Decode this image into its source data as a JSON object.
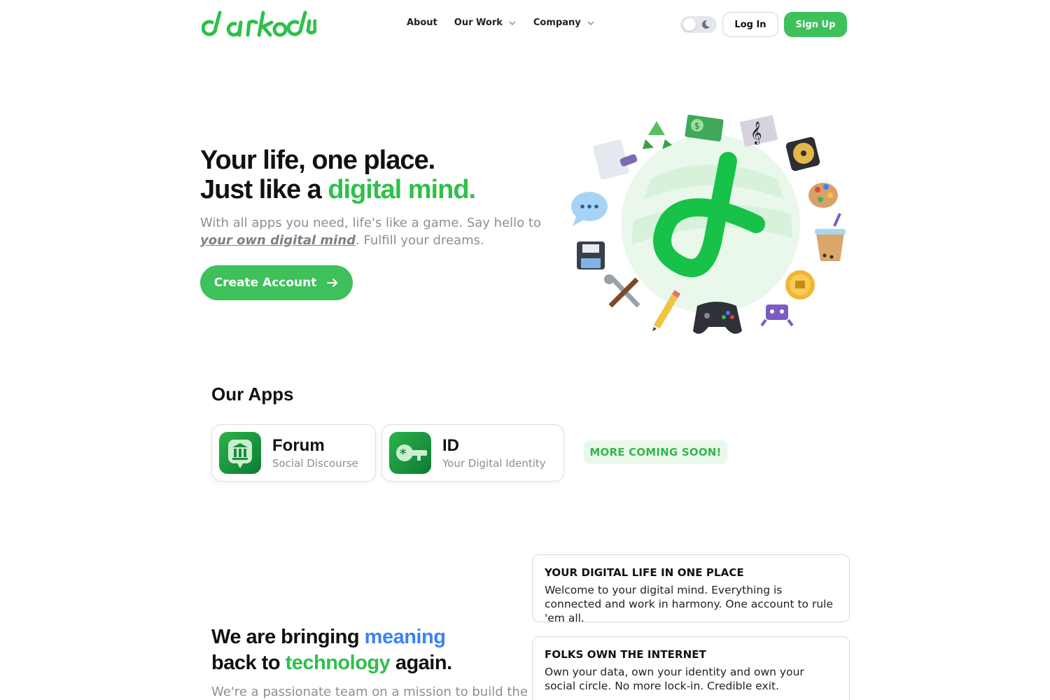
{
  "header": {
    "brand": "darkodu",
    "nav": [
      {
        "label": "About",
        "has_dropdown": false
      },
      {
        "label": "Our Work",
        "has_dropdown": true
      },
      {
        "label": "Company",
        "has_dropdown": true
      }
    ],
    "theme_toggle": {
      "mode": "light",
      "icon": "moon-icon"
    },
    "login_label": "Log In",
    "signup_label": "Sign Up"
  },
  "hero": {
    "title_line1": "Your life, one place.",
    "title_line2_prefix": "Just like a ",
    "title_line2_highlight": "digital mind.",
    "subtitle_part1": "With all apps you need, life's like a game. Say hello to ",
    "subtitle_emphasis": "your own digital mind",
    "subtitle_part2": ". Fulfill your dreams.",
    "cta_label": "Create Account",
    "illustration_icons": [
      "recycle-icon",
      "money-icon",
      "music-sheet-icon",
      "document-icon",
      "cd-icon",
      "palette-icon",
      "speech-bubble-icon",
      "bubble-tea-icon",
      "floppy-disk-icon",
      "coin-icon",
      "tools-icon",
      "pencil-icon",
      "game-controller-icon",
      "space-invader-icon"
    ]
  },
  "apps": {
    "title": "Our Apps",
    "items": [
      {
        "name": "Forum",
        "description": "Social Discourse",
        "icon": "forum-icon"
      },
      {
        "name": "ID",
        "description": "Your Digital Identity",
        "icon": "key-icon"
      }
    ],
    "coming_soon": "MORE COMING SOON!"
  },
  "mission": {
    "title_part1": "We are bringing ",
    "title_highlight1": "meaning",
    "title_part2": "back to ",
    "title_highlight2": "technology",
    "title_part3": " again.",
    "subtitle": "We're a passionate team on a mission to build the"
  },
  "features": [
    {
      "title": "YOUR DIGITAL LIFE IN ONE PLACE",
      "body": "Welcome to your digital mind. Everything is connected and work in harmony. One account to rule 'em all."
    },
    {
      "title": "FOLKS OWN THE INTERNET",
      "body": "Own your data, own your identity and own your social circle. No more lock-in. Credible exit."
    }
  ],
  "colors": {
    "brand_green": "#3ec05a",
    "accent_blue": "#3b82f6",
    "muted_text": "#8a8f98"
  }
}
